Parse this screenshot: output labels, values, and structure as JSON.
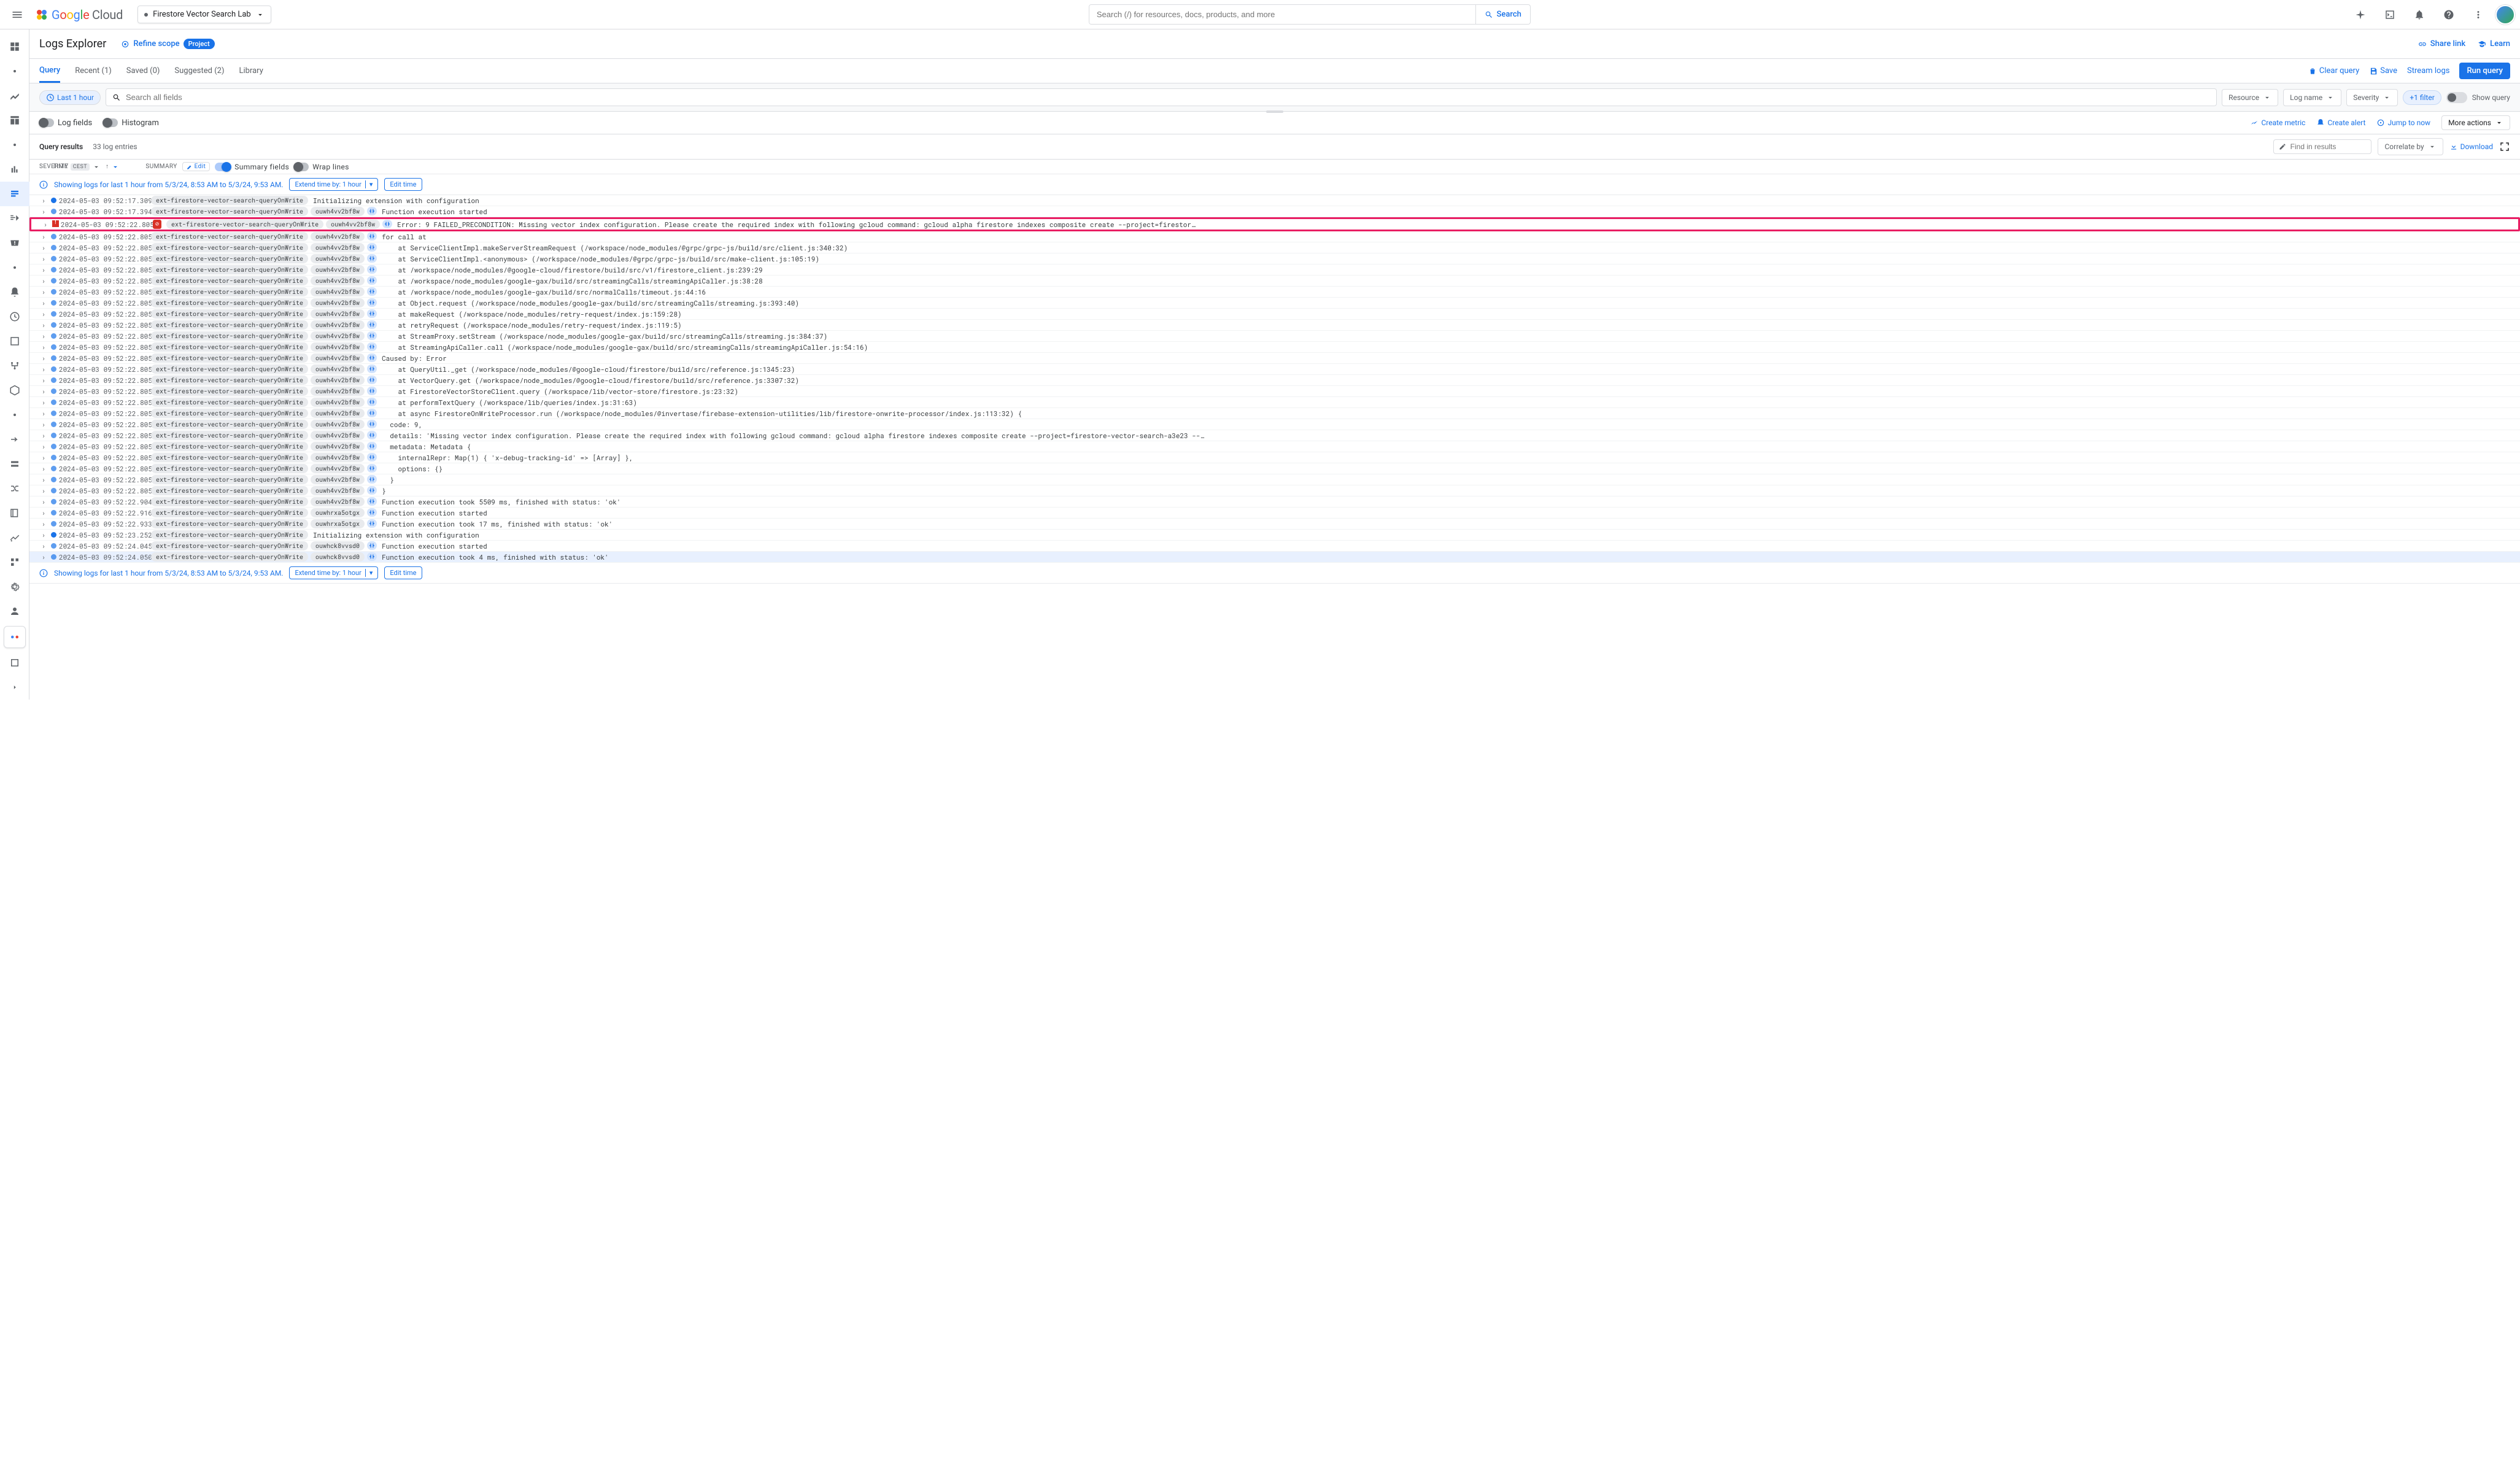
{
  "header": {
    "brand_google": "Google",
    "brand_cloud": "Cloud",
    "project_name": "Firestore Vector Search Lab",
    "search_placeholder": "Search (/) for resources, docs, products, and more",
    "search_btn": "Search"
  },
  "title_bar": {
    "title": "Logs Explorer",
    "refine": "Refine scope",
    "refine_badge": "Project",
    "share": "Share link",
    "learn": "Learn"
  },
  "tabs": {
    "query": "Query",
    "recent": "Recent (1)",
    "saved": "Saved (0)",
    "suggested": "Suggested (2)",
    "library": "Library",
    "clear": "Clear query",
    "save": "Save",
    "stream": "Stream logs",
    "run": "Run query"
  },
  "query_bar": {
    "time_chip": "Last 1 hour",
    "search_all": "Search all fields",
    "dd_resource": "Resource",
    "dd_logname": "Log name",
    "dd_severity": "Severity",
    "plus_filter": "+1 filter",
    "show_query": "Show query"
  },
  "opts": {
    "log_fields": "Log fields",
    "histogram": "Histogram",
    "create_metric": "Create metric",
    "create_alert": "Create alert",
    "jump_now": "Jump to now",
    "more": "More actions"
  },
  "results_hdr": {
    "label": "Query results",
    "count": "33 log entries",
    "find_ph": "Find in results",
    "correlate": "Correlate by",
    "download": "Download"
  },
  "cols": {
    "severity": "Severity",
    "time": "Time",
    "tz": "CEST",
    "summary": "Summary",
    "edit": "Edit",
    "summary_fields": "Summary fields",
    "wrap": "Wrap lines"
  },
  "info_bar": {
    "msg": "Showing logs for last 1 hour from 5/3/24, 8:53 AM to 5/3/24, 9:53 AM.",
    "extend": "Extend time by: 1 hour",
    "edit_time": "Edit time"
  },
  "fn": "ext-firestore-vector-search-queryOnWrite",
  "exec1": "ouwh4vv2bf8w",
  "exec2": "ouwhrxa5otgx",
  "exec3": "ouwhck8vvsd0",
  "rows": [
    {
      "sev": "info",
      "ts": "2024-05-03 09:52:17.309",
      "chips": [
        "fn"
      ],
      "msg": "Initializing extension with configuration"
    },
    {
      "sev": "debug",
      "ts": "2024-05-03 09:52:17.394",
      "chips": [
        "fn",
        "exec1",
        "icon"
      ],
      "msg": "Function execution started"
    },
    {
      "sev": "error",
      "ts": "2024-05-03 09:52:22.805",
      "chips": [
        "errbadge",
        "fn",
        "exec1",
        "icon"
      ],
      "msg": "Error: 9 FAILED_PRECONDITION: Missing vector index configuration. Please create the required index with following gcloud command: gcloud alpha firestore indexes composite create --project=firestor…",
      "hl": true
    },
    {
      "sev": "debug",
      "ts": "2024-05-03 09:52:22.805",
      "chips": [
        "fn",
        "exec1",
        "icon"
      ],
      "msg": "for call at"
    },
    {
      "sev": "debug",
      "ts": "2024-05-03 09:52:22.805",
      "chips": [
        "fn",
        "exec1",
        "icon"
      ],
      "msg": "    at ServiceClientImpl.makeServerStreamRequest (/workspace/node_modules/@grpc/grpc-js/build/src/client.js:340:32)"
    },
    {
      "sev": "debug",
      "ts": "2024-05-03 09:52:22.805",
      "chips": [
        "fn",
        "exec1",
        "icon"
      ],
      "msg": "    at ServiceClientImpl.<anonymous> (/workspace/node_modules/@grpc/grpc-js/build/src/make-client.js:105:19)"
    },
    {
      "sev": "debug",
      "ts": "2024-05-03 09:52:22.805",
      "chips": [
        "fn",
        "exec1",
        "icon"
      ],
      "msg": "    at /workspace/node_modules/@google-cloud/firestore/build/src/v1/firestore_client.js:239:29"
    },
    {
      "sev": "debug",
      "ts": "2024-05-03 09:52:22.805",
      "chips": [
        "fn",
        "exec1",
        "icon"
      ],
      "msg": "    at /workspace/node_modules/google-gax/build/src/streamingCalls/streamingApiCaller.js:38:28"
    },
    {
      "sev": "debug",
      "ts": "2024-05-03 09:52:22.805",
      "chips": [
        "fn",
        "exec1",
        "icon"
      ],
      "msg": "    at /workspace/node_modules/google-gax/build/src/normalCalls/timeout.js:44:16"
    },
    {
      "sev": "debug",
      "ts": "2024-05-03 09:52:22.805",
      "chips": [
        "fn",
        "exec1",
        "icon"
      ],
      "msg": "    at Object.request (/workspace/node_modules/google-gax/build/src/streamingCalls/streaming.js:393:40)"
    },
    {
      "sev": "debug",
      "ts": "2024-05-03 09:52:22.805",
      "chips": [
        "fn",
        "exec1",
        "icon"
      ],
      "msg": "    at makeRequest (/workspace/node_modules/retry-request/index.js:159:28)"
    },
    {
      "sev": "debug",
      "ts": "2024-05-03 09:52:22.805",
      "chips": [
        "fn",
        "exec1",
        "icon"
      ],
      "msg": "    at retryRequest (/workspace/node_modules/retry-request/index.js:119:5)"
    },
    {
      "sev": "debug",
      "ts": "2024-05-03 09:52:22.805",
      "chips": [
        "fn",
        "exec1",
        "icon"
      ],
      "msg": "    at StreamProxy.setStream (/workspace/node_modules/google-gax/build/src/streamingCalls/streaming.js:384:37)"
    },
    {
      "sev": "debug",
      "ts": "2024-05-03 09:52:22.805",
      "chips": [
        "fn",
        "exec1",
        "icon"
      ],
      "msg": "    at StreamingApiCaller.call (/workspace/node_modules/google-gax/build/src/streamingCalls/streamingApiCaller.js:54:16)"
    },
    {
      "sev": "debug",
      "ts": "2024-05-03 09:52:22.805",
      "chips": [
        "fn",
        "exec1",
        "icon"
      ],
      "msg": "Caused by: Error"
    },
    {
      "sev": "debug",
      "ts": "2024-05-03 09:52:22.805",
      "chips": [
        "fn",
        "exec1",
        "icon"
      ],
      "msg": "    at QueryUtil._get (/workspace/node_modules/@google-cloud/firestore/build/src/reference.js:1345:23)"
    },
    {
      "sev": "debug",
      "ts": "2024-05-03 09:52:22.805",
      "chips": [
        "fn",
        "exec1",
        "icon"
      ],
      "msg": "    at VectorQuery.get (/workspace/node_modules/@google-cloud/firestore/build/src/reference.js:3307:32)"
    },
    {
      "sev": "debug",
      "ts": "2024-05-03 09:52:22.805",
      "chips": [
        "fn",
        "exec1",
        "icon"
      ],
      "msg": "    at FirestoreVectorStoreClient.query (/workspace/lib/vector-store/firestore.js:23:32)"
    },
    {
      "sev": "debug",
      "ts": "2024-05-03 09:52:22.805",
      "chips": [
        "fn",
        "exec1",
        "icon"
      ],
      "msg": "    at performTextQuery (/workspace/lib/queries/index.js:31:63)"
    },
    {
      "sev": "debug",
      "ts": "2024-05-03 09:52:22.805",
      "chips": [
        "fn",
        "exec1",
        "icon"
      ],
      "msg": "    at async FirestoreOnWriteProcessor.run (/workspace/node_modules/@invertase/firebase-extension-utilities/lib/firestore-onwrite-processor/index.js:113:32) {"
    },
    {
      "sev": "debug",
      "ts": "2024-05-03 09:52:22.805",
      "chips": [
        "fn",
        "exec1",
        "icon"
      ],
      "msg": "  code: 9,"
    },
    {
      "sev": "debug",
      "ts": "2024-05-03 09:52:22.805",
      "chips": [
        "fn",
        "exec1",
        "icon"
      ],
      "msg": "  details: 'Missing vector index configuration. Please create the required index with following gcloud command: gcloud alpha firestore indexes composite create --project=firestore-vector-search-a3e23 --…"
    },
    {
      "sev": "debug",
      "ts": "2024-05-03 09:52:22.805",
      "chips": [
        "fn",
        "exec1",
        "icon"
      ],
      "msg": "  metadata: Metadata {"
    },
    {
      "sev": "debug",
      "ts": "2024-05-03 09:52:22.805",
      "chips": [
        "fn",
        "exec1",
        "icon"
      ],
      "msg": "    internalRepr: Map(1) { 'x-debug-tracking-id' => [Array] },"
    },
    {
      "sev": "debug",
      "ts": "2024-05-03 09:52:22.805",
      "chips": [
        "fn",
        "exec1",
        "icon"
      ],
      "msg": "    options: {}"
    },
    {
      "sev": "debug",
      "ts": "2024-05-03 09:52:22.805",
      "chips": [
        "fn",
        "exec1",
        "icon"
      ],
      "msg": "  }"
    },
    {
      "sev": "debug",
      "ts": "2024-05-03 09:52:22.805",
      "chips": [
        "fn",
        "exec1",
        "icon"
      ],
      "msg": "}"
    },
    {
      "sev": "debug",
      "ts": "2024-05-03 09:52:22.904",
      "chips": [
        "fn",
        "exec1",
        "icon"
      ],
      "msg": "Function execution took 5509 ms, finished with status: 'ok'"
    },
    {
      "sev": "debug",
      "ts": "2024-05-03 09:52:22.916",
      "chips": [
        "fn",
        "exec2",
        "icon"
      ],
      "msg": "Function execution started"
    },
    {
      "sev": "debug",
      "ts": "2024-05-03 09:52:22.933",
      "chips": [
        "fn",
        "exec2",
        "icon"
      ],
      "msg": "Function execution took 17 ms, finished with status: 'ok'"
    },
    {
      "sev": "info",
      "ts": "2024-05-03 09:52:23.252",
      "chips": [
        "fn"
      ],
      "msg": "Initializing extension with configuration"
    },
    {
      "sev": "debug",
      "ts": "2024-05-03 09:52:24.045",
      "chips": [
        "fn",
        "exec3",
        "icon"
      ],
      "msg": "Function execution started"
    },
    {
      "sev": "debug",
      "ts": "2024-05-03 09:52:24.050",
      "chips": [
        "fn",
        "exec3",
        "icon"
      ],
      "msg": "Function execution took 4 ms, finished with status: 'ok'",
      "sel": true
    }
  ]
}
